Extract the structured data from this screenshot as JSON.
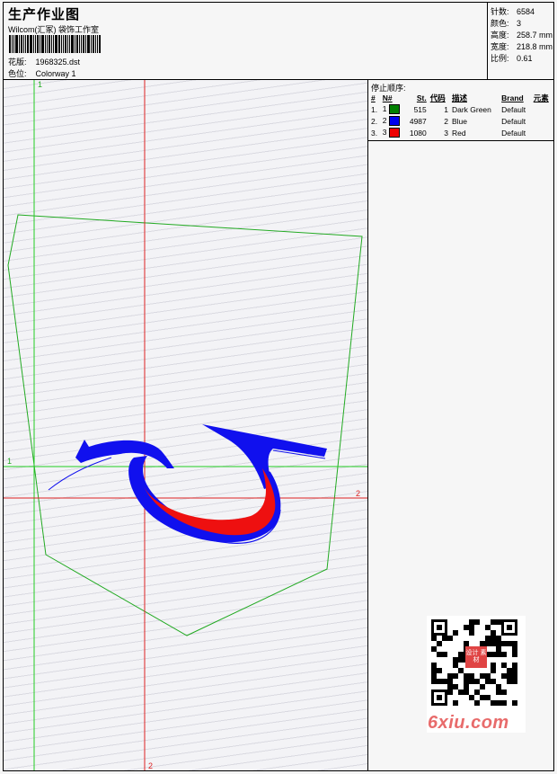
{
  "header": {
    "title": "生产作业图",
    "company": "Wilcom(汇冢) 袋饰工作室",
    "design_label": "花版:",
    "design_value": "1968325.dst",
    "colorway_label": "色位:",
    "colorway_value": "Colorway 1"
  },
  "stats": [
    {
      "label": "针数:",
      "value": "6584"
    },
    {
      "label": "颜色:",
      "value": "3"
    },
    {
      "label": "高度:",
      "value": "258.7 mm"
    },
    {
      "label": "宽度:",
      "value": "218.8 mm"
    },
    {
      "label": "比例:",
      "value": "0.61"
    }
  ],
  "stop_sequence": {
    "title": "停止顺序:",
    "columns": [
      "#",
      "N#",
      "St.",
      "代码",
      "描述",
      "Brand",
      "元素"
    ],
    "rows": [
      {
        "idx": "1.",
        "n": "1",
        "color": "#008000",
        "st": "515",
        "code": "1",
        "desc": "Dark Green",
        "brand": "Default",
        "elem": ""
      },
      {
        "idx": "2.",
        "n": "2",
        "color": "#0000ee",
        "st": "4987",
        "code": "2",
        "desc": "Blue",
        "brand": "Default",
        "elem": ""
      },
      {
        "idx": "3.",
        "n": "3",
        "color": "#ee0000",
        "st": "1080",
        "code": "3",
        "desc": "Red",
        "brand": "Default",
        "elem": ""
      }
    ]
  },
  "canvas": {
    "guide_labels": {
      "green_top": "1",
      "green_left": "1",
      "red_right": "2",
      "red_bottom": "2"
    },
    "colors": {
      "outline": "#22aa22",
      "blue": "#1010ee",
      "red": "#ee1010",
      "guide_green": "#22cc22",
      "guide_red": "#dd2222"
    }
  },
  "qr_block": {
    "stamp_text": "设计 素材",
    "watermark": "6xiu.com"
  }
}
